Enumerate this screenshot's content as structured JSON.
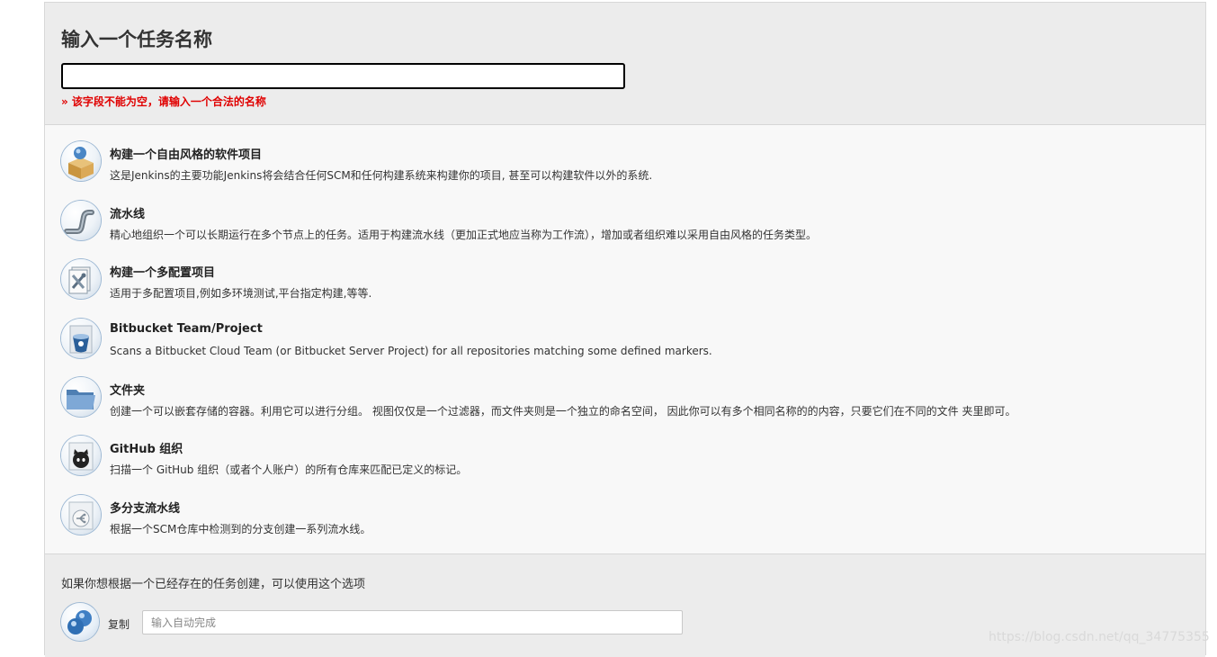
{
  "form": {
    "title": "输入一个任务名称",
    "name_value": "",
    "error": "» 该字段不能为空，请输入一个合法的名称"
  },
  "job_types": [
    {
      "title": "构建一个自由风格的软件项目",
      "desc": "这是Jenkins的主要功能Jenkins将会结合任何SCM和任何构建系统来构建你的项目, 甚至可以构建软件以外的系统.",
      "icon": "freestyle-box-icon"
    },
    {
      "title": "流水线",
      "desc": "精心地组织一个可以长期运行在多个节点上的任务。适用于构建流水线（更加正式地应当称为工作流），增加或者组织难以采用自由风格的任务类型。",
      "icon": "pipeline-icon"
    },
    {
      "title": "构建一个多配置项目",
      "desc": "适用于多配置项目,例如多环境测试,平台指定构建,等等.",
      "icon": "multi-config-icon"
    },
    {
      "title": "Bitbucket Team/Project",
      "desc": "Scans a Bitbucket Cloud Team (or Bitbucket Server Project) for all repositories matching some defined markers.",
      "icon": "bitbucket-icon"
    },
    {
      "title": "文件夹",
      "desc": "创建一个可以嵌套存储的容器。利用它可以进行分组。 视图仅仅是一个过滤器，而文件夹则是一个独立的命名空间， 因此你可以有多个相同名称的的内容，只要它们在不同的文件 夹里即可。",
      "icon": "folder-icon"
    },
    {
      "title": "GitHub 组织",
      "desc": "扫描一个 GitHub 组织（或者个人账户）的所有仓库来匹配已定义的标记。",
      "icon": "github-icon"
    },
    {
      "title": "多分支流水线",
      "desc": "根据一个SCM仓库中检测到的分支创建一系列流水线。",
      "icon": "multibranch-icon"
    }
  ],
  "copy": {
    "hint": "如果你想根据一个已经存在的任务创建，可以使用这个选项",
    "label": "复制",
    "placeholder": "输入自动完成",
    "icon": "copy-job-icon"
  },
  "watermark": "https://blog.csdn.net/qq_34775355"
}
